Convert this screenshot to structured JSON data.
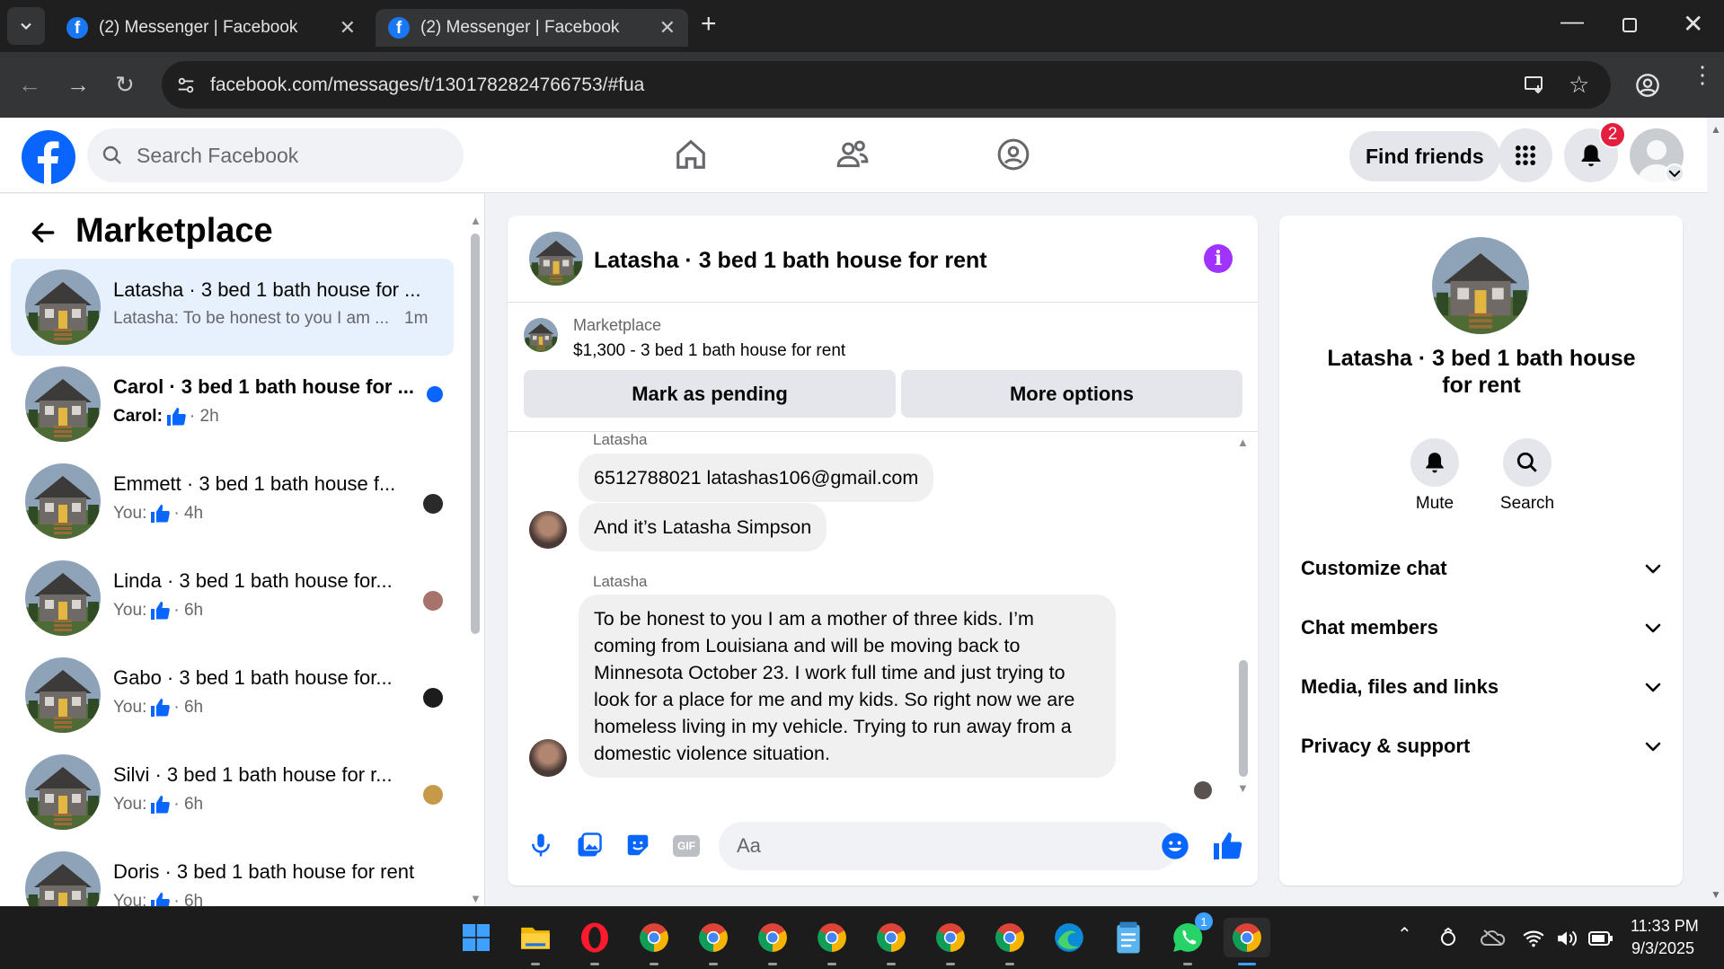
{
  "browser": {
    "tabs": [
      {
        "title": "(2) Messenger | Facebook"
      },
      {
        "title": "(2) Messenger | Facebook"
      }
    ],
    "url": "facebook.com/messages/t/1301782824766753/#fua"
  },
  "header": {
    "search_placeholder": "Search Facebook",
    "find_friends": "Find friends",
    "notification_count": "2"
  },
  "sidebar": {
    "title": "Marketplace",
    "conversations": [
      {
        "name": "Latasha · 3 bed 1 bath house for ...",
        "snippet": "Latasha: To be honest to you I am ...",
        "time": "1m",
        "active": true
      },
      {
        "name": "Carol · 3 bed 1 bath house for ...",
        "sender": "Carol:",
        "time": "· 2h",
        "unread": true
      },
      {
        "name": "Emmett · 3 bed 1 bath house f...",
        "sender": "You:",
        "time": "· 4h"
      },
      {
        "name": "Linda · 3 bed 1 bath house for...",
        "sender": "You:",
        "time": "· 6h"
      },
      {
        "name": "Gabo · 3 bed 1 bath house for...",
        "sender": "You:",
        "time": "· 6h"
      },
      {
        "name": "Silvi · 3 bed 1 bath house for r...",
        "sender": "You:",
        "time": "· 6h"
      },
      {
        "name": "Doris · 3 bed 1 bath house for rent",
        "sender": "You:",
        "time": "· 6h"
      }
    ]
  },
  "chat": {
    "title": "Latasha · 3 bed 1 bath house for rent",
    "listing_label": "Marketplace",
    "listing_price_title": "$1,300 - 3 bed 1 bath house for rent",
    "mark_pending": "Mark as pending",
    "more_options": "More options",
    "messages": [
      {
        "sender": "Latasha",
        "text": "6512788021 latashas106@gmail.com"
      },
      {
        "text": "And it’s Latasha Simpson"
      },
      {
        "sender": "Latasha",
        "text": "To be honest to you I am a mother of three kids. I’m coming from Louisiana and will be moving back to Minnesota October 23. I work full time and just trying to look for a place for me and  my kids. So right now we are homeless living in my vehicle. Trying to run away from a domestic violence situation."
      }
    ],
    "composer_placeholder": "Aa"
  },
  "info_panel": {
    "title": "Latasha · 3 bed 1 bath house for rent",
    "mute": "Mute",
    "search": "Search",
    "sections": [
      "Customize chat",
      "Chat members",
      "Media, files and links",
      "Privacy & support"
    ]
  },
  "taskbar": {
    "time": "11:33 PM",
    "date": "9/3/2025",
    "whatsapp_badge": "1"
  },
  "colors": {
    "facebook_blue": "#0866ff",
    "messenger_purple": "#a033ff",
    "unread_dot": "#0866ff"
  }
}
